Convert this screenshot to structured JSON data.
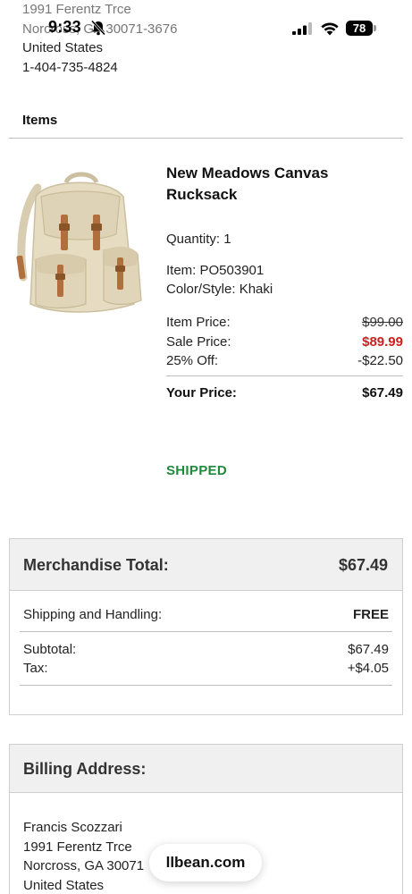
{
  "shipping_address": {
    "street": "1991 Ferentz Trce",
    "city_line": "Norcross, GA 30071-3676",
    "country": "United States",
    "phone": "1-404-735-4824"
  },
  "status_bar": {
    "time": "9:33",
    "battery": "78"
  },
  "items": {
    "heading": "Items",
    "product": {
      "name": "New Meadows Canvas Rucksack",
      "quantity": "Quantity: 1",
      "item_no": "Item: PO503901",
      "color_style": "Color/Style: Khaki",
      "item_price_label": "Item Price:",
      "item_price": "$99.00",
      "sale_price_label": "Sale Price:",
      "sale_price": "$89.99",
      "discount_label": "25% Off:",
      "discount": "-$22.50",
      "your_price_label": "Your Price:",
      "your_price": "$67.49",
      "status": "SHIPPED",
      "image_icon": "backpack-image"
    }
  },
  "totals": {
    "merch_label": "Merchandise Total:",
    "merch_value": "$67.49",
    "shipping_label": "Shipping and Handling:",
    "shipping_value": "FREE",
    "subtotal_label": "Subtotal:",
    "subtotal_value": "$67.49",
    "tax_label": "Tax:",
    "tax_value": "+$4.05"
  },
  "billing": {
    "heading": "Billing Address:",
    "name": "Francis Scozzari",
    "street": "1991 Ferentz Trce",
    "city_line": "Norcross, GA 30071",
    "country": "United States"
  },
  "browser": {
    "url": "llbean.com"
  },
  "colors": {
    "sale_red": "#cc1f1f",
    "shipped_green": "#1f8a3c",
    "panel_gray": "#f0f0f0"
  }
}
